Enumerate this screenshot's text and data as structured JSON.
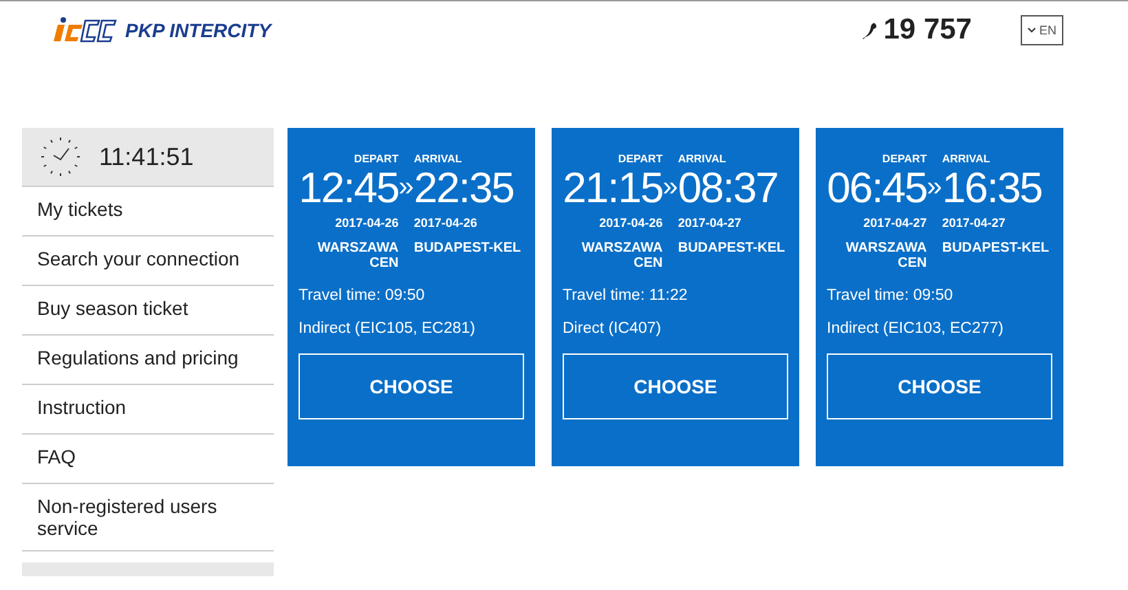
{
  "header": {
    "brand": "PKP INTERCITY",
    "phone": "19 757",
    "language": "EN"
  },
  "sidebar": {
    "clock": "11:41:51",
    "items": [
      {
        "label": "My tickets"
      },
      {
        "label": "Search your connection"
      },
      {
        "label": "Buy season ticket"
      },
      {
        "label": "Regulations and pricing"
      },
      {
        "label": "Instruction"
      },
      {
        "label": "FAQ"
      },
      {
        "label": "Non-registered users service"
      }
    ]
  },
  "connections": [
    {
      "depart_label": "DEPART",
      "arrival_label": "ARRIVAL",
      "depart_time": "12:45",
      "separator": "»",
      "arrival_time": "22:35",
      "depart_date": "2017-04-26",
      "arrival_date": "2017-04-26",
      "from": "WARSZAWA CEN",
      "to": "BUDAPEST-KEL",
      "travel_time": "Travel time: 09:50",
      "route": "Indirect (EIC105, EC281)",
      "button": "CHOOSE"
    },
    {
      "depart_label": "DEPART",
      "arrival_label": "ARRIVAL",
      "depart_time": "21:15",
      "separator": "»",
      "arrival_time": "08:37",
      "depart_date": "2017-04-26",
      "arrival_date": "2017-04-27",
      "from": "WARSZAWA CEN",
      "to": "BUDAPEST-KEL",
      "travel_time": "Travel time: 11:22",
      "route": "Direct (IC407)",
      "button": "CHOOSE"
    },
    {
      "depart_label": "DEPART",
      "arrival_label": "ARRIVAL",
      "depart_time": "06:45",
      "separator": "»",
      "arrival_time": "16:35",
      "depart_date": "2017-04-27",
      "arrival_date": "2017-04-27",
      "from": "WARSZAWA CEN",
      "to": "BUDAPEST-KEL",
      "travel_time": "Travel time: 09:50",
      "route": "Indirect (EIC103, EC277)",
      "button": "CHOOSE"
    }
  ]
}
